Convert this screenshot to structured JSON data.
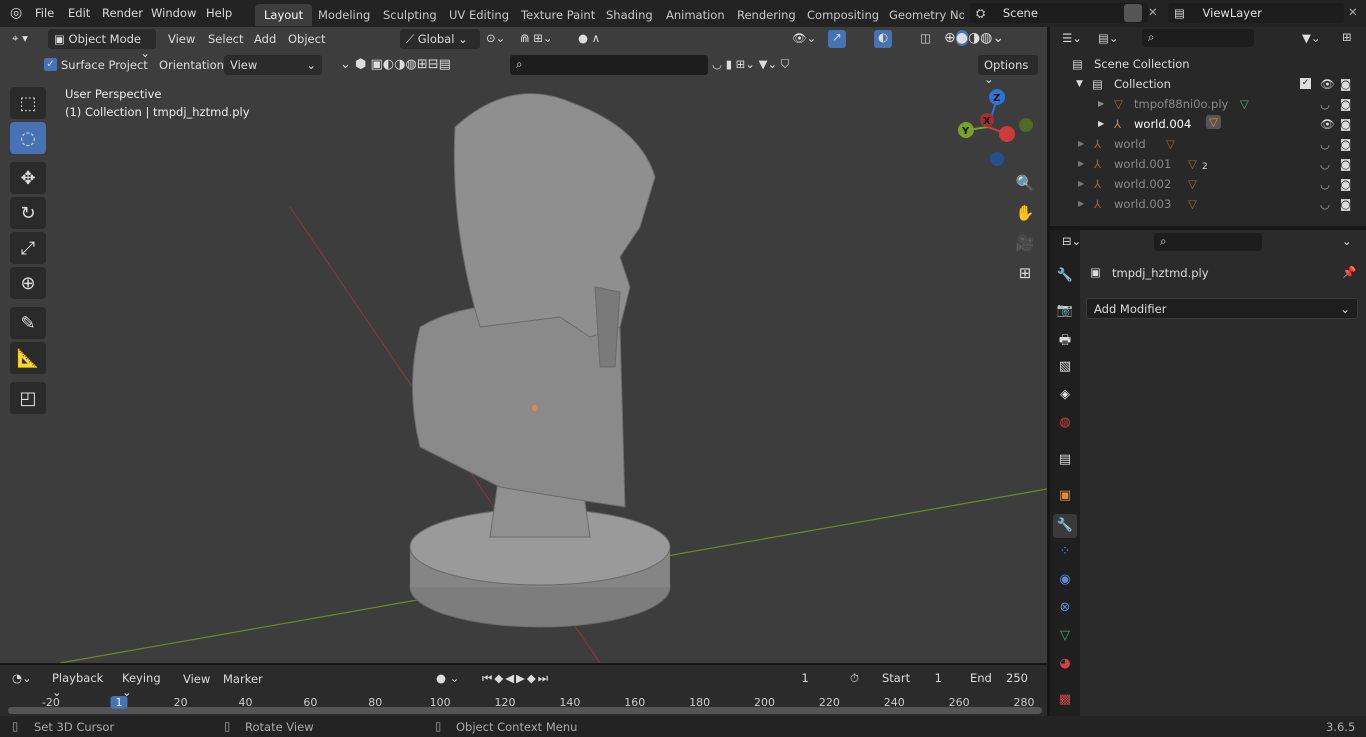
{
  "topbar": {
    "menus": [
      "File",
      "Edit",
      "Render",
      "Window",
      "Help"
    ],
    "workspaces": [
      "Layout",
      "Modeling",
      "Sculpting",
      "UV Editing",
      "Texture Paint",
      "Shading",
      "Animation",
      "Rendering",
      "Compositing",
      "Geometry Noc"
    ],
    "active_workspace": "Layout",
    "scene": "Scene",
    "view_layer": "ViewLayer"
  },
  "viewport": {
    "mode": "Object Mode",
    "menus": [
      "View",
      "Select",
      "Add",
      "Object"
    ],
    "transform_orientation": "Global",
    "surface_project": "Surface Project",
    "surface_project_checked": true,
    "orientation_label": "Orientation:",
    "orientation_value": "View",
    "options": "Options",
    "overlay_title": "User Perspective",
    "overlay_subtitle": "(1) Collection | tmpdj_hztmd.ply",
    "gizmo_axes": [
      "Z",
      "Y",
      "X"
    ],
    "tools": [
      "select-box-icon",
      "cursor-icon",
      "move-icon",
      "rotate-icon",
      "scale-icon",
      "transform-icon",
      "annotate-icon",
      "measure-icon",
      "add-cube-icon"
    ],
    "active_tool": "cursor-icon"
  },
  "outliner": {
    "scene_collection": "Scene Collection",
    "collection": "Collection",
    "items": [
      {
        "name": "tmpof88ni0o.ply",
        "dim": true,
        "indent": 2
      },
      {
        "name": "world.004",
        "dim": false,
        "indent": 2
      },
      {
        "name": "world",
        "dim": true,
        "indent": 1
      },
      {
        "name": "world.001",
        "dim": true,
        "indent": 1,
        "badge": "2"
      },
      {
        "name": "world.002",
        "dim": true,
        "indent": 1
      },
      {
        "name": "world.003",
        "dim": true,
        "indent": 1
      }
    ]
  },
  "properties": {
    "object": "tmpdj_hztmd.ply",
    "add_modifier": "Add Modifier"
  },
  "timeline": {
    "menus": [
      "Playback",
      "Keying",
      "View",
      "Marker"
    ],
    "current_frame": "1",
    "start_label": "Start",
    "start": "1",
    "end_label": "End",
    "end": "250",
    "ticks": [
      "-20",
      "1",
      "20",
      "40",
      "60",
      "80",
      "100",
      "120",
      "140",
      "160",
      "180",
      "200",
      "220",
      "240",
      "260",
      "280"
    ]
  },
  "status": {
    "hint1": "Set 3D Cursor",
    "hint2": "Rotate View",
    "hint3": "Object Context Menu",
    "version": "3.6.5"
  },
  "colors": {
    "accent": "#4772b3",
    "object_orange": "#e08a3c",
    "x_axis": "#d03a3a",
    "y_axis": "#79a12a",
    "z_axis": "#2d73d8"
  }
}
